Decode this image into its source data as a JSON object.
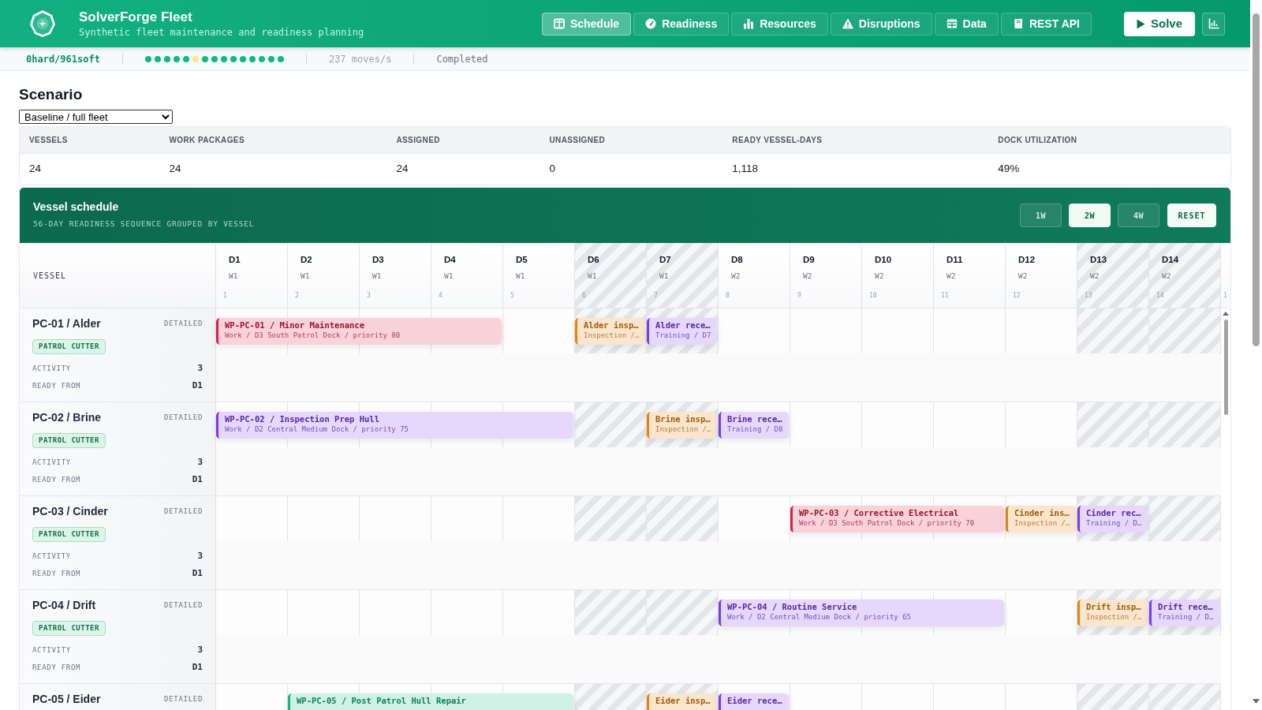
{
  "header": {
    "title": "SolverForge Fleet",
    "subtitle": "Synthetic fleet maintenance and readiness planning"
  },
  "nav": [
    {
      "label": "Schedule",
      "selected": true
    },
    {
      "label": "Readiness",
      "selected": false
    },
    {
      "label": "Resources",
      "selected": false
    },
    {
      "label": "Disruptions",
      "selected": false
    },
    {
      "label": "Data",
      "selected": false
    },
    {
      "label": "REST API",
      "selected": false
    }
  ],
  "solve": "Solve",
  "status_bar": {
    "score": "0hard/961soft",
    "dots": [
      {
        "color": "#10b981"
      },
      {
        "color": "#10b981"
      },
      {
        "color": "#10b981"
      },
      {
        "color": "#10b981"
      },
      {
        "color": "#10b981"
      },
      {
        "color": "#fde68a"
      },
      {
        "color": "#10b981"
      },
      {
        "color": "#10b981"
      },
      {
        "color": "#10b981"
      },
      {
        "color": "#10b981"
      },
      {
        "color": "#10b981"
      },
      {
        "color": "#10b981"
      },
      {
        "color": "#10b981"
      },
      {
        "color": "#10b981"
      },
      {
        "color": "#10b981"
      }
    ],
    "rate": "237 moves/s",
    "state": "Completed"
  },
  "scenario": {
    "title": "Scenario",
    "value": "Baseline / full fleet"
  },
  "stats": [
    {
      "label": "VESSELS",
      "value": "24"
    },
    {
      "label": "WORK PACKAGES",
      "value": "24"
    },
    {
      "label": "ASSIGNED",
      "value": "24"
    },
    {
      "label": "UNASSIGNED",
      "value": "0"
    },
    {
      "label": "READY VESSEL-DAYS",
      "value": "1,118"
    },
    {
      "label": "DOCK UTILIZATION",
      "value": "49%"
    }
  ],
  "schedule": {
    "title": "Vessel schedule",
    "subtitle": "56-DAY READINESS SEQUENCE GROUPED BY VESSEL",
    "zoom": [
      {
        "label": "1W",
        "selected": false
      },
      {
        "label": "2W",
        "selected": true
      },
      {
        "label": "4W",
        "selected": false
      }
    ],
    "reset": "RESET",
    "vessel_header": "VESSEL",
    "days": [
      {
        "label": "D1",
        "week": "W1",
        "number": "1",
        "weekend": false
      },
      {
        "label": "D2",
        "week": "W1",
        "number": "2",
        "weekend": false
      },
      {
        "label": "D3",
        "week": "W1",
        "number": "3",
        "weekend": false
      },
      {
        "label": "D4",
        "week": "W1",
        "number": "4",
        "weekend": false
      },
      {
        "label": "D5",
        "week": "W1",
        "number": "5",
        "weekend": false
      },
      {
        "label": "D6",
        "week": "W1",
        "number": "6",
        "weekend": true
      },
      {
        "label": "D7",
        "week": "W1",
        "number": "7",
        "weekend": true
      },
      {
        "label": "D8",
        "week": "W2",
        "number": "8",
        "weekend": false
      },
      {
        "label": "D9",
        "week": "W2",
        "number": "9",
        "weekend": false
      },
      {
        "label": "D10",
        "week": "W2",
        "number": "10",
        "weekend": false
      },
      {
        "label": "D11",
        "week": "W2",
        "number": "11",
        "weekend": false
      },
      {
        "label": "D12",
        "week": "W2",
        "number": "12",
        "weekend": false
      },
      {
        "label": "D13",
        "week": "W2",
        "number": "13",
        "weekend": true
      },
      {
        "label": "D14",
        "week": "W2",
        "number": "14",
        "weekend": true
      },
      {
        "number": "1",
        "weekend": false
      }
    ],
    "vessels": [
      {
        "name": "PC-01 / Alder",
        "mode": "DETAILED",
        "type": "PATROL CUTTER",
        "fields": [
          {
            "label": "ACTIVITY",
            "value": "3"
          },
          {
            "label": "READY FROM",
            "value": "D1"
          }
        ],
        "lane": [
          {
            "kind": "task",
            "title": "WP-PC-01 / Minor Maintenance",
            "detail": "Work / D3 South Patrol Dock / priority 80",
            "color": "#e11d48"
          },
          {
            "kind": "cont"
          },
          {
            "kind": "cont"
          },
          {
            "kind": "cont"
          },
          {
            "kind": "free"
          },
          {
            "kind": "task",
            "title": "Alder insp…",
            "detail": "Inspection /…",
            "color": "#e8820c"
          },
          {
            "kind": "task",
            "title": "Alder rece…",
            "detail": "Training / D7",
            "color": "#7c3aed"
          },
          {
            "kind": "free"
          },
          {
            "kind": "free"
          },
          {
            "kind": "free"
          },
          {
            "kind": "free"
          },
          {
            "kind": "free"
          },
          {
            "kind": "free"
          },
          {
            "kind": "free"
          }
        ]
      },
      {
        "name": "PC-02 / Brine",
        "mode": "DETAILED",
        "type": "PATROL CUTTER",
        "fields": [
          {
            "label": "ACTIVITY",
            "value": "3"
          },
          {
            "label": "READY FROM",
            "value": "D1"
          }
        ],
        "lane": [
          {
            "kind": "task",
            "title": "WP-PC-02 / Inspection Prep Hull",
            "detail": "Work / D2 Central Medium Dock / priority 75",
            "color": "#7c3aed"
          },
          {
            "kind": "cont"
          },
          {
            "kind": "cont"
          },
          {
            "kind": "cont"
          },
          {
            "kind": "cont"
          },
          {
            "kind": "free"
          },
          {
            "kind": "task",
            "title": "Brine insp…",
            "detail": "Inspection /…",
            "color": "#e8820c"
          },
          {
            "kind": "task",
            "title": "Brine rece…",
            "detail": "Training / D8",
            "color": "#7c3aed"
          },
          {
            "kind": "free"
          },
          {
            "kind": "free"
          },
          {
            "kind": "free"
          },
          {
            "kind": "free"
          },
          {
            "kind": "free"
          },
          {
            "kind": "free"
          }
        ]
      },
      {
        "name": "PC-03 / Cinder",
        "mode": "DETAILED",
        "type": "PATROL CUTTER",
        "fields": [
          {
            "label": "ACTIVITY",
            "value": "3"
          },
          {
            "label": "READY FROM",
            "value": "D1"
          }
        ],
        "lane": [
          {
            "kind": "free"
          },
          {
            "kind": "free"
          },
          {
            "kind": "free"
          },
          {
            "kind": "free"
          },
          {
            "kind": "free"
          },
          {
            "kind": "free"
          },
          {
            "kind": "free"
          },
          {
            "kind": "free"
          },
          {
            "kind": "task",
            "title": "WP-PC-03 / Corrective Electrical",
            "detail": "Work / D3 South Patrol Dock / priority 70",
            "color": "#e11d48"
          },
          {
            "kind": "cont"
          },
          {
            "kind": "cont"
          },
          {
            "kind": "task",
            "title": "Cinder ins…",
            "detail": "Inspection /…",
            "color": "#e8820c"
          },
          {
            "kind": "task",
            "title": "Cinder rec…",
            "detail": "Training / D…",
            "color": "#7c3aed"
          },
          {
            "kind": "free"
          }
        ]
      },
      {
        "name": "PC-04 / Drift",
        "mode": "DETAILED",
        "type": "PATROL CUTTER",
        "fields": [
          {
            "label": "ACTIVITY",
            "value": "3"
          },
          {
            "label": "READY FROM",
            "value": "D1"
          }
        ],
        "lane": [
          {
            "kind": "free"
          },
          {
            "kind": "free"
          },
          {
            "kind": "free"
          },
          {
            "kind": "free"
          },
          {
            "kind": "free"
          },
          {
            "kind": "free"
          },
          {
            "kind": "free"
          },
          {
            "kind": "task",
            "title": "WP-PC-04 / Routine Service",
            "detail": "Work / D2 Central Medium Dock / priority 65",
            "color": "#7c3aed"
          },
          {
            "kind": "cont"
          },
          {
            "kind": "cont"
          },
          {
            "kind": "cont"
          },
          {
            "kind": "free"
          },
          {
            "kind": "task",
            "title": "Drift insp…",
            "detail": "Inspection /…",
            "color": "#e8820c"
          },
          {
            "kind": "task",
            "title": "Drift rece…",
            "detail": "Training / D…",
            "color": "#7c3aed"
          }
        ]
      },
      {
        "name": "PC-05 / Eider",
        "mode": "DETAILED",
        "lane": [
          {
            "kind": "free"
          },
          {
            "kind": "task",
            "title": "WP-PC-05 / Post Patrol Hull Repair",
            "color": "#10b981"
          },
          {
            "kind": "cont"
          },
          {
            "kind": "cont"
          },
          {
            "kind": "cont"
          },
          {
            "kind": "free"
          },
          {
            "kind": "task",
            "title": "Eider insp…",
            "color": "#e8820c"
          },
          {
            "kind": "task",
            "title": "Eider rece…",
            "color": "#7c3aed"
          },
          {
            "kind": "free"
          },
          {
            "kind": "free"
          },
          {
            "kind": "free"
          },
          {
            "kind": "free"
          },
          {
            "kind": "free"
          },
          {
            "kind": "free"
          }
        ]
      }
    ]
  }
}
